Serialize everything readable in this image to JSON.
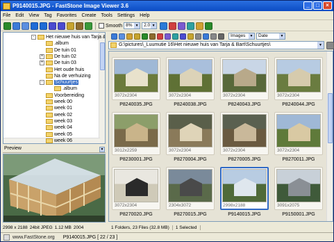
{
  "window": {
    "title": "P9140015.JPG - FastStone Image Viewer 3.6"
  },
  "menu": [
    "File",
    "Edit",
    "View",
    "Tag",
    "Favorites",
    "Create",
    "Tools",
    "Settings",
    "Help"
  ],
  "toolbar": {
    "smooth_label": "Smooth",
    "zoom_value": "8%",
    "ratio_value": "2.0",
    "icon_colors": [
      "#2a8a2a",
      "#3b7bd8",
      "#5b8fe0",
      "#1f6cd6",
      "#1f6cd6",
      "#4b4bd0",
      "#4b4bd0",
      "#c7a42e",
      "#8c6b2e",
      "#3a9a3a",
      "#2a7bd8",
      "#d04040",
      "#7a5ad0",
      "#2ea0a0",
      "#d0a030",
      "#2a8a2a"
    ]
  },
  "tree": {
    "items": [
      {
        "label": "Het nieuwe huis van Tarja & Bart",
        "indent": 0,
        "exp": "-",
        "selected": false
      },
      {
        "label": ".album",
        "indent": 1,
        "exp": "",
        "selected": false
      },
      {
        "label": "De tuin 01",
        "indent": 1,
        "exp": "",
        "selected": false
      },
      {
        "label": "De tuin 02",
        "indent": 1,
        "exp": "+",
        "selected": false
      },
      {
        "label": "De tuin 03",
        "indent": 1,
        "exp": "+",
        "selected": false
      },
      {
        "label": "Het oude huis",
        "indent": 1,
        "exp": "",
        "selected": false
      },
      {
        "label": "Na de verhuizing",
        "indent": 1,
        "exp": "",
        "selected": false
      },
      {
        "label": "Schuurtjes",
        "indent": 1,
        "exp": "-",
        "selected": true
      },
      {
        "label": ".album",
        "indent": 2,
        "exp": "",
        "selected": false
      },
      {
        "label": "Voorbereiding",
        "indent": 1,
        "exp": "",
        "selected": false
      },
      {
        "label": "week 00",
        "indent": 1,
        "exp": "",
        "selected": false
      },
      {
        "label": "week 01",
        "indent": 1,
        "exp": "",
        "selected": false
      },
      {
        "label": "week 02",
        "indent": 1,
        "exp": "",
        "selected": false
      },
      {
        "label": "week 03",
        "indent": 1,
        "exp": "",
        "selected": false
      },
      {
        "label": "week 04",
        "indent": 1,
        "exp": "",
        "selected": false
      },
      {
        "label": "week 05",
        "indent": 1,
        "exp": "",
        "selected": false
      },
      {
        "label": "week 06",
        "indent": 1,
        "exp": "",
        "selected": false
      }
    ]
  },
  "preview": {
    "title": "Preview"
  },
  "status_left": {
    "dims": "2998 x 2188",
    "bits": "24bit JPEG",
    "size": "1.12 MB",
    "date": "2004"
  },
  "filter": {
    "type": "Images",
    "sort": "Date"
  },
  "path": "G:\\pictures\\_Luumutie 16\\Het nieuwe huis van Tarja & Bart\\Schuurtjes\\",
  "thumbs": [
    {
      "dim": "3072x2304",
      "name": "P8240035.JPG",
      "sel": false,
      "sky": "#9fb8d6",
      "ground": "#6b7a3c",
      "obj": "#e8e2cc"
    },
    {
      "dim": "3072x2304",
      "name": "P8240038.JPG",
      "sel": false,
      "sky": "#a9bfdc",
      "ground": "#5f7135",
      "obj": "#dcd3b8"
    },
    {
      "dim": "3072x2304",
      "name": "P8240043.JPG",
      "sel": false,
      "sky": "#c9d6e6",
      "ground": "#58683a",
      "obj": "#b8a98a"
    },
    {
      "dim": "3072x2304",
      "name": "P8240044.JPG",
      "sel": false,
      "sky": "#b7cbe2",
      "ground": "#6a7c40",
      "obj": "#d6cbad"
    },
    {
      "dim": "3012x2259",
      "name": "P8230001.JPG",
      "sel": false,
      "sky": "#8c9e6a",
      "ground": "#7a6a4a",
      "obj": "#c9b48a"
    },
    {
      "dim": "3072x2304",
      "name": "P8270004.JPG",
      "sel": false,
      "sky": "#5a5f4a",
      "ground": "#8a7a5a",
      "obj": "#dfd4b8"
    },
    {
      "dim": "3072x2304",
      "name": "P8270005.JPG",
      "sel": false,
      "sky": "#5a6050",
      "ground": "#6a5a40",
      "obj": "#c9b89a"
    },
    {
      "dim": "3072x2304",
      "name": "P8270011.JPG",
      "sel": false,
      "sky": "#9fb8d6",
      "ground": "#5f7a3a",
      "obj": "#d9c9a3"
    },
    {
      "dim": "3072x2304",
      "name": "P8270020.JPG",
      "sel": false,
      "sky": "#e9e7e0",
      "ground": "#cfcab8",
      "obj": "#2a2a2a"
    },
    {
      "dim": "2304x3072",
      "name": "P8270015.JPG",
      "sel": false,
      "sky": "#7a8a9a",
      "ground": "#5a6a4a",
      "obj": "#4a4a4a"
    },
    {
      "dim": "2998x2188",
      "name": "P9140015.JPG",
      "sel": true,
      "sky": "#b8cce2",
      "ground": "#4f6a3a",
      "obj": "#dfe7ee"
    },
    {
      "dim": "3091x2075",
      "name": "P9150001.JPG",
      "sel": false,
      "sky": "#c8d0d8",
      "ground": "#3f5a3a",
      "obj": "#8a8f95"
    }
  ],
  "status_right": {
    "folders": "1 Folders, 23 Files (32.8 MB)",
    "selected": "1 Selected"
  },
  "bottom": {
    "site": "www.FastStone.org",
    "file": "P9140015.JPG [ 22 / 23 ]"
  }
}
